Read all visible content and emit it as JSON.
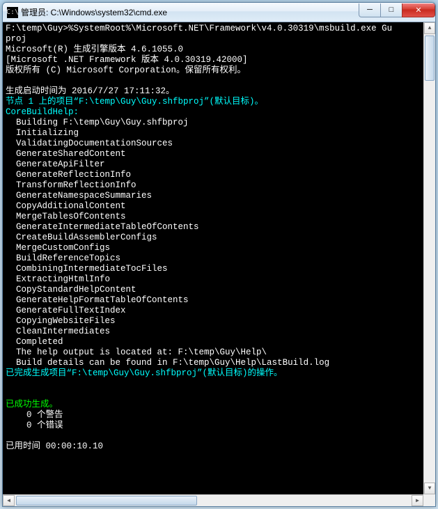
{
  "window": {
    "title": "管理员: C:\\Windows\\system32\\cmd.exe",
    "icon_label": "cmd-icon"
  },
  "buttons": {
    "min_glyph": "─",
    "max_glyph": "□",
    "close_glyph": "✕"
  },
  "console": {
    "lines": [
      {
        "cls": "c-white",
        "text": "F:\\temp\\Guy>%SystemRoot%\\Microsoft.NET\\Framework\\v4.0.30319\\msbuild.exe Gu"
      },
      {
        "cls": "c-white",
        "text": "proj"
      },
      {
        "cls": "c-white",
        "text": "Microsoft(R) 生成引擎版本 4.6.1055.0"
      },
      {
        "cls": "c-white",
        "text": "[Microsoft .NET Framework 版本 4.0.30319.42000]"
      },
      {
        "cls": "c-white",
        "text": "版权所有 (C) Microsoft Corporation。保留所有权利。"
      },
      {
        "cls": "c-white",
        "text": ""
      },
      {
        "cls": "c-white",
        "text": "生成启动时间为 2016/7/27 17:11:32。"
      },
      {
        "cls": "c-cyan",
        "text": "节点 1 上的项目“F:\\temp\\Guy\\Guy.shfbproj”(默认目标)。"
      },
      {
        "cls": "c-cyan",
        "text": "CoreBuildHelp:"
      },
      {
        "cls": "c-white",
        "text": "  Building F:\\temp\\Guy\\Guy.shfbproj"
      },
      {
        "cls": "c-white",
        "text": "  Initializing"
      },
      {
        "cls": "c-white",
        "text": "  ValidatingDocumentationSources"
      },
      {
        "cls": "c-white",
        "text": "  GenerateSharedContent"
      },
      {
        "cls": "c-white",
        "text": "  GenerateApiFilter"
      },
      {
        "cls": "c-white",
        "text": "  GenerateReflectionInfo"
      },
      {
        "cls": "c-white",
        "text": "  TransformReflectionInfo"
      },
      {
        "cls": "c-white",
        "text": "  GenerateNamespaceSummaries"
      },
      {
        "cls": "c-white",
        "text": "  CopyAdditionalContent"
      },
      {
        "cls": "c-white",
        "text": "  MergeTablesOfContents"
      },
      {
        "cls": "c-white",
        "text": "  GenerateIntermediateTableOfContents"
      },
      {
        "cls": "c-white",
        "text": "  CreateBuildAssemblerConfigs"
      },
      {
        "cls": "c-white",
        "text": "  MergeCustomConfigs"
      },
      {
        "cls": "c-white",
        "text": "  BuildReferenceTopics"
      },
      {
        "cls": "c-white",
        "text": "  CombiningIntermediateTocFiles"
      },
      {
        "cls": "c-white",
        "text": "  ExtractingHtmlInfo"
      },
      {
        "cls": "c-white",
        "text": "  CopyStandardHelpContent"
      },
      {
        "cls": "c-white",
        "text": "  GenerateHelpFormatTableOfContents"
      },
      {
        "cls": "c-white",
        "text": "  GenerateFullTextIndex"
      },
      {
        "cls": "c-white",
        "text": "  CopyingWebsiteFiles"
      },
      {
        "cls": "c-white",
        "text": "  CleanIntermediates"
      },
      {
        "cls": "c-white",
        "text": "  Completed"
      },
      {
        "cls": "c-white",
        "text": "  The help output is located at: F:\\temp\\Guy\\Help\\"
      },
      {
        "cls": "c-white",
        "text": "  Build details can be found in F:\\temp\\Guy\\Help\\LastBuild.log"
      },
      {
        "cls": "c-cyan",
        "text": "已完成生成项目“F:\\temp\\Guy\\Guy.shfbproj”(默认目标)的操作。"
      },
      {
        "cls": "c-white",
        "text": ""
      },
      {
        "cls": "c-white",
        "text": ""
      },
      {
        "cls": "c-green",
        "text": "已成功生成。"
      },
      {
        "cls": "c-white",
        "text": "    0 个警告"
      },
      {
        "cls": "c-white",
        "text": "    0 个错误"
      },
      {
        "cls": "c-white",
        "text": ""
      },
      {
        "cls": "c-white",
        "text": "已用时间 00:00:10.10"
      }
    ]
  },
  "scroll": {
    "up": "▲",
    "down": "▼",
    "left": "◀",
    "right": "▶"
  }
}
